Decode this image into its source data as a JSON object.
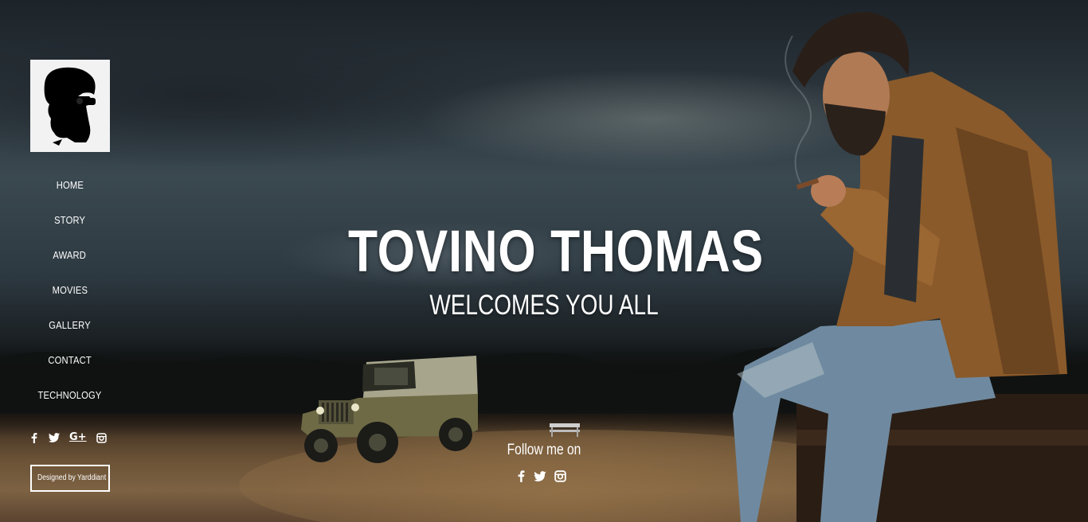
{
  "page": {
    "title": "TOVINO THOMAS",
    "subtitle": "WELCOMES YOU ALL",
    "follow_label": "Follow me on"
  },
  "sidebar": {
    "logo_icon": "bearded-man-sunglasses-logo",
    "nav_items": [
      {
        "label": "HOME"
      },
      {
        "label": "STORY"
      },
      {
        "label": "AWARD"
      },
      {
        "label": "MOVIES"
      },
      {
        "label": "GALLERY"
      },
      {
        "label": "CONTACT"
      },
      {
        "label": "TECHNOLOGY"
      }
    ],
    "social": [
      {
        "icon": "facebook-icon",
        "glyph": "f"
      },
      {
        "icon": "twitter-icon",
        "glyph": "🐦"
      },
      {
        "icon": "google-plus-icon",
        "glyph": "G+"
      },
      {
        "icon": "instagram-icon",
        "glyph": "◙"
      }
    ],
    "designed_by": "Designed by Yarddiant"
  },
  "center_social": [
    {
      "icon": "facebook-icon",
      "glyph": "f"
    },
    {
      "icon": "twitter-icon",
      "glyph": "🐦"
    },
    {
      "icon": "instagram-icon",
      "glyph": "◙"
    }
  ],
  "colors": {
    "text": "#ffffff",
    "logo_bg": "#f2f2f2",
    "sky_dark": "#1c2329",
    "ground": "#7d6243",
    "jacket": "#8a5a2a",
    "jeans": "#6f8aa0",
    "jeep": "#6e6a45"
  }
}
